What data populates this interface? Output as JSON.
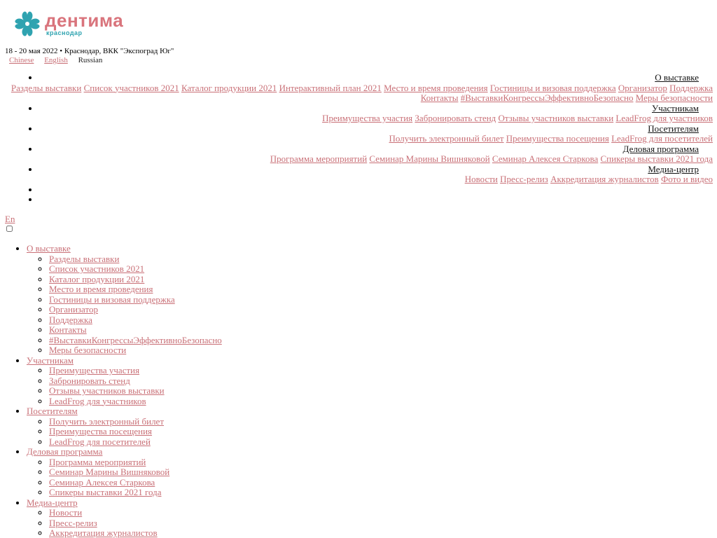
{
  "brand": {
    "name": "дентима",
    "city": "краснодар",
    "colors": {
      "pink": "#d9747c",
      "teal": "#2fa3b0",
      "link": "#c97077"
    }
  },
  "event_info": "18 - 20 мая 2022 • Краснодар, ВКК \"Экспоград Юг\"",
  "languages": {
    "chinese": "Chinese",
    "english": "English",
    "russian": "Russian"
  },
  "nav": [
    {
      "label": "О выставке",
      "items": [
        "Разделы выставки",
        "Список участников 2021",
        "Каталог продукции 2021",
        "Интерактивный план 2021",
        "Место и время проведения",
        "Гостиницы и визовая поддержка",
        "Организатор",
        "Поддержка",
        "Контакты",
        "#ВыставкиКонгрессыЭффективноБезопасно",
        "Меры безопасности"
      ]
    },
    {
      "label": "Участникам",
      "items": [
        "Преимущества участия",
        "Забронировать стенд",
        "Отзывы участников выставки",
        "LeadFrog для участников"
      ]
    },
    {
      "label": "Посетителям",
      "items": [
        "Получить электронный билет",
        "Преимущества посещения",
        "LeadFrog для посетителей"
      ]
    },
    {
      "label": "Деловая программа",
      "items": [
        "Программа мероприятий",
        "Семинар Марины Вишняковой",
        "Семинар Алексея Старкова",
        "Спикеры выставки 2021 года"
      ]
    },
    {
      "label": "Медиа-центр",
      "items": [
        "Новости",
        "Пресс-релиз",
        "Аккредитация журналистов",
        "Фото и видео"
      ]
    }
  ],
  "lang_switch": "En",
  "mobile_nav": [
    {
      "label": "О выставке",
      "items": [
        "Разделы выставки",
        "Список участников 2021",
        "Каталог продукции 2021",
        "Место и время проведения",
        "Гостиницы и визовая поддержка",
        "Организатор",
        "Поддержка",
        "Контакты",
        "#ВыставкиКонгрессыЭффективноБезопасно",
        "Меры безопасности"
      ]
    },
    {
      "label": "Участникам",
      "items": [
        "Преимущества участия",
        "Забронировать стенд",
        "Отзывы участников выставки",
        "LeadFrog для участников"
      ]
    },
    {
      "label": "Посетителям",
      "items": [
        "Получить электронный билет",
        "Преимущества посещения",
        "LeadFrog для посетителей"
      ]
    },
    {
      "label": "Деловая программа",
      "items": [
        "Программа мероприятий",
        "Семинар Марины Вишняковой",
        "Семинар Алексея Старкова",
        "Спикеры выставки 2021 года"
      ]
    },
    {
      "label": "Медиа-центр",
      "items": [
        "Новости",
        "Пресс-релиз",
        "Аккредитация журналистов"
      ]
    }
  ]
}
